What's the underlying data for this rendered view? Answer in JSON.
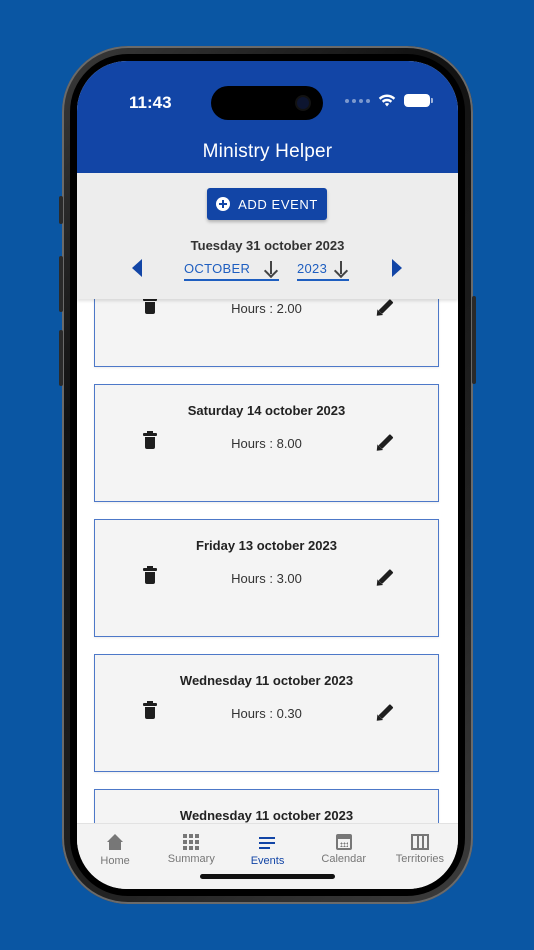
{
  "status_bar": {
    "time": "11:43"
  },
  "app": {
    "title": "Ministry Helper",
    "header_color": "#1245a6"
  },
  "controls": {
    "add_event_label": "ADD EVENT",
    "current_date": "Tuesday 31 october 2023",
    "month_value": "OCTOBER",
    "year_value": "2023"
  },
  "events": [
    {
      "date": "",
      "hours": "Hours : 2.00"
    },
    {
      "date": "Saturday 14 october 2023",
      "hours": "Hours : 8.00"
    },
    {
      "date": "Friday 13 october 2023",
      "hours": "Hours : 3.00"
    },
    {
      "date": "Wednesday 11 october 2023",
      "hours": "Hours : 0.30"
    },
    {
      "date": "Wednesday 11 october 2023",
      "hours": ""
    }
  ],
  "tabs": [
    {
      "label": "Home",
      "icon": "home-icon",
      "active": false
    },
    {
      "label": "Summary",
      "icon": "grid-icon",
      "active": false
    },
    {
      "label": "Events",
      "icon": "list-icon",
      "active": true
    },
    {
      "label": "Calendar",
      "icon": "calendar-icon",
      "active": false
    },
    {
      "label": "Territories",
      "icon": "map-icon",
      "active": false
    }
  ]
}
